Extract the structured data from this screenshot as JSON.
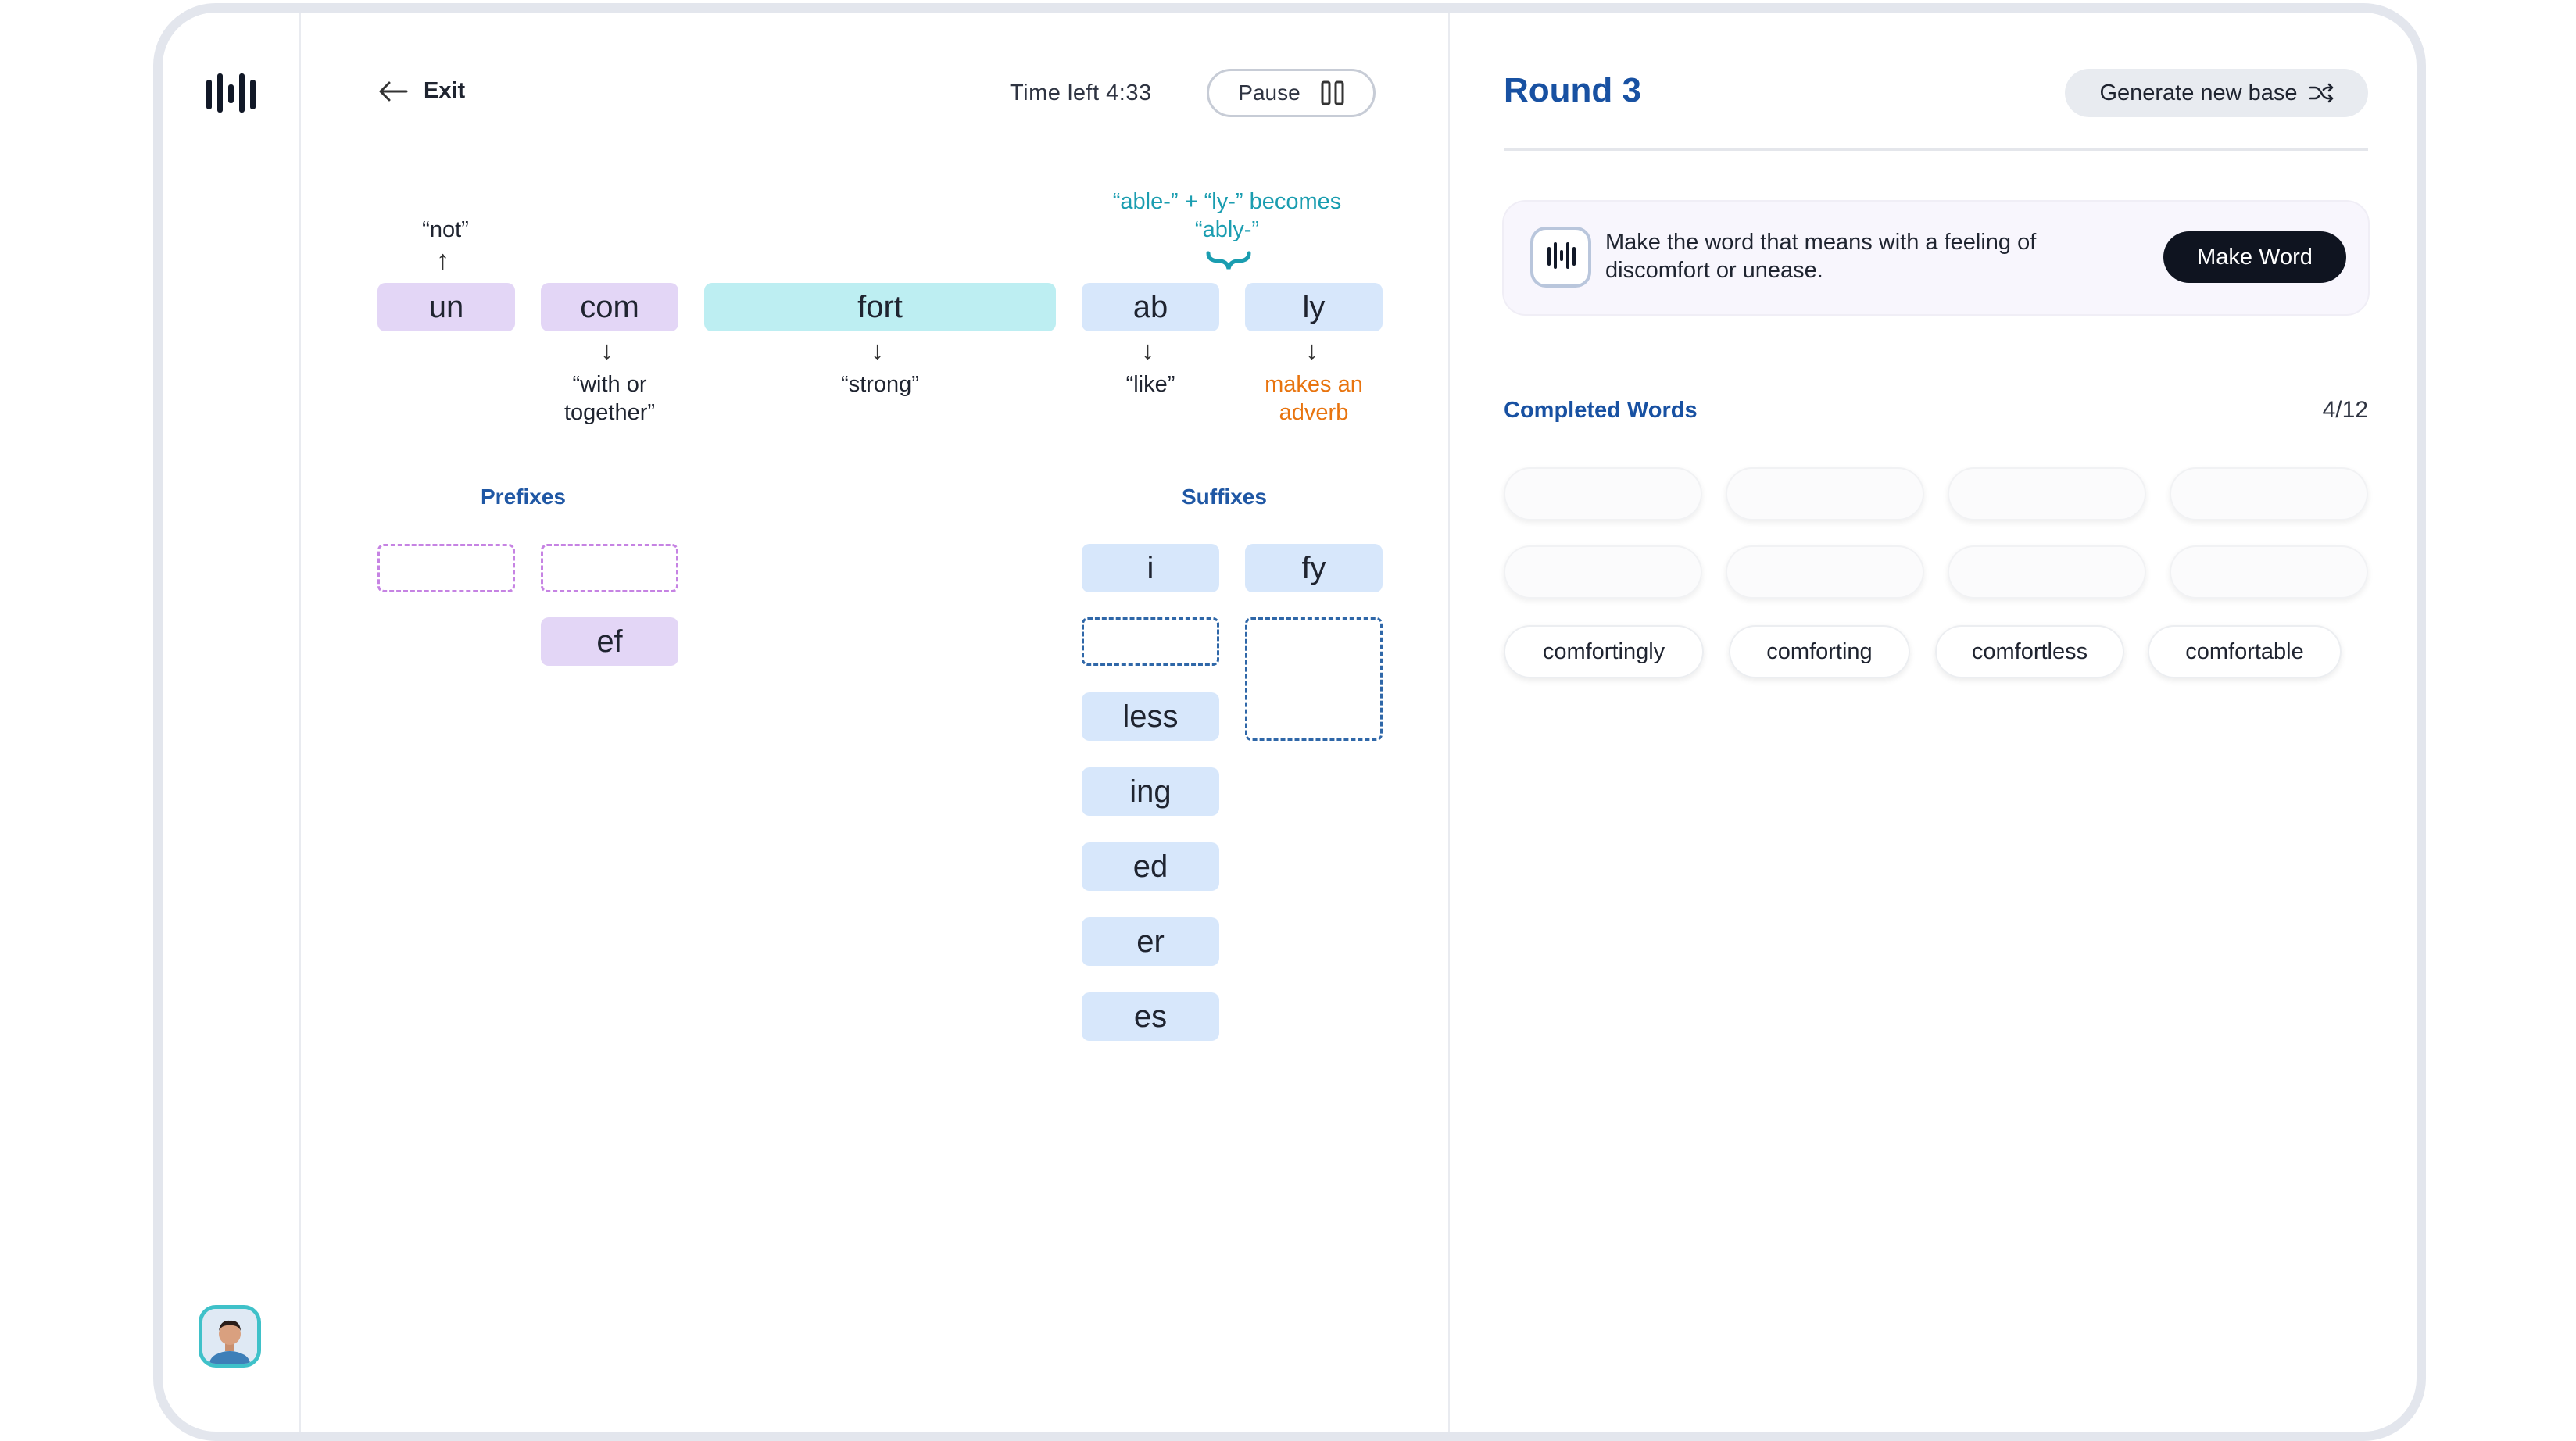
{
  "header": {
    "exit_label": "Exit",
    "time_left": "Time left 4:33",
    "pause_label": "Pause"
  },
  "word": {
    "prefix_tiles": [
      "un",
      "com"
    ],
    "base": "fort",
    "suffix_tiles": [
      "ab",
      "ly"
    ],
    "glosses": {
      "un": "“not”",
      "com_line1": "“with or",
      "com_line2": "together”",
      "fort": "“strong”",
      "ab": "“like”",
      "ly_line1": "makes an",
      "ly_line2": "adverb",
      "rule_line1": "“able-” + “ly-” becomes",
      "rule_line2": "“ably-”"
    }
  },
  "prefixes": {
    "label": "Prefixes",
    "tiles": [
      "ef"
    ]
  },
  "suffixes": {
    "label": "Suffixes",
    "tiles": [
      "i",
      "fy",
      "less",
      "ing",
      "ed",
      "er",
      "es"
    ]
  },
  "round": {
    "title": "Round 3",
    "generate_label": "Generate new base"
  },
  "prompt": {
    "text": "Make the word that means with a feeling of discomfort or unease.",
    "button": "Make Word"
  },
  "completed": {
    "label": "Completed Words",
    "count": "4/12",
    "words": [
      "comfortingly",
      "comforting",
      "comfortless",
      "comfortable"
    ]
  },
  "colors": {
    "accent_blue": "#1851a2",
    "prefix_purple": "#e3d6f6",
    "base_cyan": "#bdeef2",
    "suffix_blue": "#d7e7fb",
    "teal_note": "#1a9db0",
    "orange_note": "#e8740f"
  },
  "icons": [
    "app-logo-icon",
    "back-arrow-icon",
    "pause-icon",
    "shuffle-icon",
    "avatar"
  ]
}
